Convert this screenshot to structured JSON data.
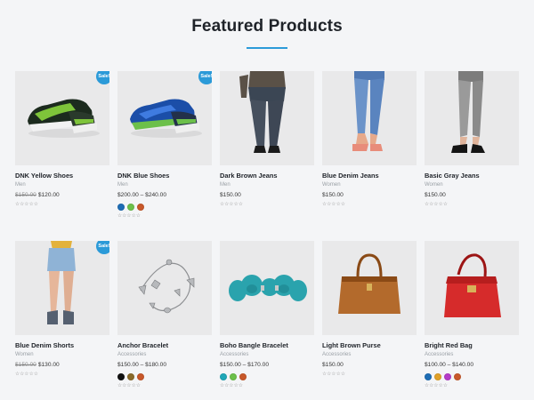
{
  "section": {
    "title": "Featured Products"
  },
  "products": [
    {
      "name": "DNK Yellow Shoes",
      "category": "Men",
      "old_price": "$150.00",
      "price": "$120.00",
      "sale": "Sale!",
      "rating": "☆☆☆☆☆",
      "swatches": [],
      "image_icon": "sneaker-green-icon"
    },
    {
      "name": "DNK Blue Shoes",
      "category": "Men",
      "old_price": "",
      "price": "$200.00 – $240.00",
      "sale": "Sale!",
      "rating": "☆☆☆☆☆",
      "swatches": [
        "#1e6db5",
        "#6cc04a",
        "#c8582a"
      ],
      "image_icon": "sneaker-blue-icon"
    },
    {
      "name": "Dark Brown Jeans",
      "category": "Men",
      "old_price": "",
      "price": "$150.00",
      "sale": "",
      "rating": "☆☆☆☆☆",
      "swatches": [],
      "image_icon": "dark-jeans-icon"
    },
    {
      "name": "Blue Denim Jeans",
      "category": "Women",
      "old_price": "",
      "price": "$150.00",
      "sale": "",
      "rating": "☆☆☆☆☆",
      "swatches": [],
      "image_icon": "blue-jeans-icon"
    },
    {
      "name": "Basic Gray Jeans",
      "category": "Women",
      "old_price": "",
      "price": "$150.00",
      "sale": "",
      "rating": "☆☆☆☆☆",
      "swatches": [],
      "image_icon": "gray-jeans-icon"
    },
    {
      "name": "Blue Denim Shorts",
      "category": "Women",
      "old_price": "$150.00",
      "price": "$130.00",
      "sale": "Sale!",
      "rating": "☆☆☆☆☆",
      "swatches": [],
      "image_icon": "denim-shorts-icon"
    },
    {
      "name": "Anchor Bracelet",
      "category": "Accessories",
      "old_price": "",
      "price": "$150.00 – $180.00",
      "sale": "",
      "rating": "☆☆☆☆☆",
      "swatches": [
        "#111111",
        "#8a6a2a",
        "#c8582a"
      ],
      "image_icon": "silver-bracelet-icon"
    },
    {
      "name": "Boho Bangle Bracelet",
      "category": "Accessories",
      "old_price": "",
      "price": "$150.00 – $170.00",
      "sale": "",
      "rating": "☆☆☆☆☆",
      "swatches": [
        "#1fa7b8",
        "#6cc04a",
        "#c8582a"
      ],
      "image_icon": "turquoise-bracelet-icon"
    },
    {
      "name": "Light Brown Purse",
      "category": "Accessories",
      "old_price": "",
      "price": "$150.00",
      "sale": "",
      "rating": "☆☆☆☆☆",
      "swatches": [],
      "image_icon": "brown-purse-icon"
    },
    {
      "name": "Bright Red Bag",
      "category": "Accessories",
      "old_price": "",
      "price": "$100.00 – $140.00",
      "sale": "",
      "rating": "☆☆☆☆☆",
      "swatches": [
        "#1e6db5",
        "#e0a12a",
        "#b53cc8",
        "#c8582a"
      ],
      "image_icon": "red-bag-icon"
    }
  ],
  "colors": {
    "accent": "#2b9ad8",
    "background": "#f4f5f7",
    "thumb_bg": "#e9e9ea"
  }
}
